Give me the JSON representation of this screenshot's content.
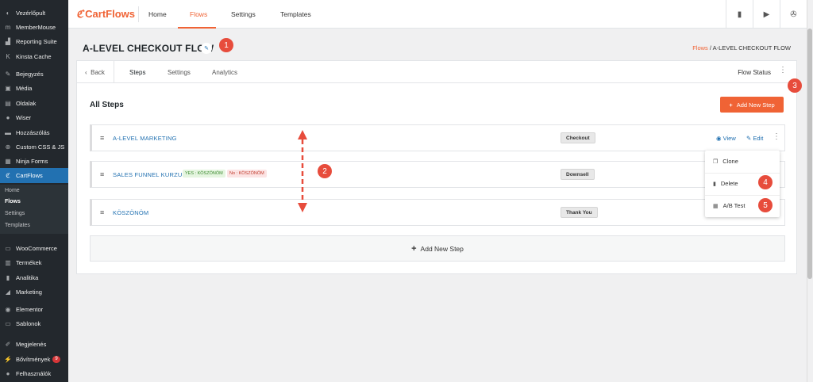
{
  "sidebar": {
    "items": [
      {
        "label": "Vezérlőpult",
        "icon": "dashboard-icon",
        "glyph": "◐"
      },
      {
        "label": "MemberMouse",
        "icon": "membermouse-icon",
        "glyph": "m"
      },
      {
        "label": "Reporting Suite",
        "icon": "chart-icon",
        "glyph": "▟"
      },
      {
        "label": "Kinsta Cache",
        "icon": "kinsta-icon",
        "glyph": "K"
      },
      {
        "label": "Bejegyzés",
        "icon": "pin-icon",
        "glyph": "✎"
      },
      {
        "label": "Média",
        "icon": "media-icon",
        "glyph": "▣"
      },
      {
        "label": "Oldalak",
        "icon": "pages-icon",
        "glyph": "▤"
      },
      {
        "label": "Wiser",
        "icon": "wiser-icon",
        "glyph": "●"
      },
      {
        "label": "Hozzászólás",
        "icon": "comment-icon",
        "glyph": "▬"
      },
      {
        "label": "Custom CSS & JS",
        "icon": "plus-circle-icon",
        "glyph": "⊕"
      },
      {
        "label": "Ninja Forms",
        "icon": "forms-icon",
        "glyph": "▦"
      },
      {
        "label": "CartFlows",
        "icon": "cartflows-icon",
        "glyph": "ℭ"
      },
      {
        "label": "WooCommerce",
        "icon": "woocommerce-icon",
        "glyph": "▭"
      },
      {
        "label": "Termékek",
        "icon": "products-icon",
        "glyph": "▥"
      },
      {
        "label": "Analitika",
        "icon": "analytics-icon",
        "glyph": "▮"
      },
      {
        "label": "Marketing",
        "icon": "megaphone-icon",
        "glyph": "◢"
      },
      {
        "label": "Elementor",
        "icon": "elementor-icon",
        "glyph": "◉"
      },
      {
        "label": "Sablonok",
        "icon": "templates-icon",
        "glyph": "▭"
      },
      {
        "label": "Megjelenés",
        "icon": "appearance-icon",
        "glyph": "✐"
      },
      {
        "label": "Bővítmények",
        "icon": "plugins-icon",
        "glyph": "⚡",
        "badge": "9"
      },
      {
        "label": "Felhasználók",
        "icon": "users-icon",
        "glyph": "●"
      }
    ],
    "submenu": [
      "Home",
      "Flows",
      "Settings",
      "Templates"
    ]
  },
  "topbar": {
    "brand": "CartFlows",
    "tabs": [
      "Home",
      "Flows",
      "Settings",
      "Templates"
    ],
    "active_tab": "Flows",
    "icons": [
      "book-icon",
      "youtube-icon",
      "support-icon"
    ]
  },
  "page": {
    "title": "A-LEVEL CHECKOUT FLOW",
    "breadcrumb_link": "Flows",
    "breadcrumb_sep": " / ",
    "breadcrumb_current": "A-LEVEL CHECKOUT FLOW"
  },
  "card": {
    "back_label": "Back",
    "tabs": [
      "Steps",
      "Settings",
      "Analytics"
    ],
    "active_tab": "Steps",
    "flow_status_label": "Flow Status",
    "section_title": "All Steps",
    "add_button_label": "Add New Step",
    "add_row_label": "Add New Step"
  },
  "steps": [
    {
      "name": "A-LEVEL MARKETING",
      "type": "Checkout",
      "tags": []
    },
    {
      "name": "SALES FUNNEL KURZUS",
      "type": "Downsell",
      "tags": [
        {
          "label": "YES : KÖSZÖNÖM",
          "kind": "yes"
        },
        {
          "label": "No : KÖSZÖNÖM",
          "kind": "no"
        }
      ]
    },
    {
      "name": "KÖSZÖNÖM",
      "type": "Thank You",
      "tags": []
    }
  ],
  "step_actions": {
    "view": "View",
    "edit": "Edit"
  },
  "dropdown": {
    "items": [
      "Clone",
      "Delete",
      "A/B Test"
    ]
  },
  "callouts": [
    "1",
    "2",
    "3",
    "4",
    "5"
  ],
  "colors": {
    "brand": "#f06335",
    "link": "#2271b1",
    "callout": "#e74c3c",
    "sidebar": "#23282d"
  }
}
